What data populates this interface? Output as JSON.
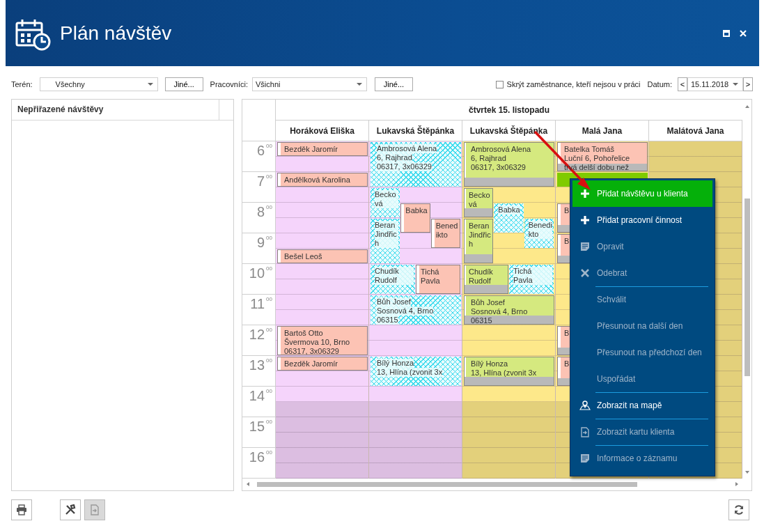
{
  "window": {
    "title": "Plán návštěv"
  },
  "filters": {
    "terrain": {
      "label": "Terén:",
      "value": "Všechny",
      "button": "Jiné..."
    },
    "workers": {
      "label": "Pracovníci:",
      "value": "Všichni",
      "button": "Jiné..."
    },
    "hide_absent": {
      "label": "Skrýt zaměstnance, kteří nejsou v práci",
      "checked": false
    },
    "date": {
      "label": "Datum:",
      "prev": "<",
      "value": "15.11.2018",
      "next": ">"
    }
  },
  "unassigned": {
    "title": "Nepřiřazené návštěvy"
  },
  "calendar": {
    "day": "čtvrtek 15. listopadu",
    "hours": [
      {
        "hour": "6",
        "minutes": "00"
      },
      {
        "hour": "7",
        "minutes": "00"
      },
      {
        "hour": "8",
        "minutes": "00"
      },
      {
        "hour": "9",
        "minutes": "00"
      },
      {
        "hour": "10",
        "minutes": "00"
      },
      {
        "hour": "11",
        "minutes": "00"
      },
      {
        "hour": "12",
        "minutes": "00"
      },
      {
        "hour": "13",
        "minutes": "00"
      },
      {
        "hour": "14",
        "minutes": "00"
      },
      {
        "hour": "15",
        "minutes": "00"
      },
      {
        "hour": "16",
        "minutes": "00"
      }
    ],
    "columns": [
      {
        "name": "Horáková Eliška",
        "events": [
          {
            "kind": "visit",
            "flag": false,
            "lines": [
              "Bezděk Jaromír"
            ]
          },
          {
            "kind": "visit",
            "flag": false,
            "lines": [
              "Andělková Karolina"
            ]
          },
          {
            "kind": "visit",
            "flag": false,
            "lines": [
              "Bešel Leoš"
            ]
          },
          {
            "kind": "visit",
            "flag": false,
            "lines": [
              "Bartoš Otto",
              "Švermova 10, Brno",
              "06317, 3x06329"
            ]
          },
          {
            "kind": "visit",
            "flag": false,
            "lines": [
              "Bezděk Jaromír"
            ]
          }
        ]
      },
      {
        "name": "Lukavská Štěpánka",
        "events": [
          {
            "kind": "hatched",
            "flag": false,
            "lines": [
              "Ambrosová Alena",
              "6, Rajhrad",
              "06317, 3x06329"
            ]
          },
          {
            "kind": "hatched",
            "flag": false,
            "lines": [
              "Becková"
            ]
          },
          {
            "kind": "hatched",
            "flag": false,
            "lines": [
              "Beran Jindřich"
            ]
          },
          {
            "kind": "visit",
            "flag": false,
            "lines": [
              "Babka"
            ]
          },
          {
            "kind": "visit",
            "flag": false,
            "lines": [
              "Benedikto"
            ]
          },
          {
            "kind": "hatched",
            "flag": false,
            "lines": [
              "Chudík Rudolf"
            ]
          },
          {
            "kind": "visit",
            "flag": false,
            "lines": [
              "Tichá Pavla"
            ]
          },
          {
            "kind": "hatched",
            "flag": false,
            "lines": [
              "Bůh Josef",
              "Sosnová 4, Brno",
              "06315"
            ]
          },
          {
            "kind": "hatched",
            "flag": false,
            "lines": [
              "Bílý Honza",
              "13, Hlína (zvonit 3x"
            ]
          }
        ]
      },
      {
        "name": "Lukavská Štěpánka",
        "events": [
          {
            "kind": "approved",
            "flag": true,
            "lines": [
              "Ambrosová Alena",
              "6, Rajhrad",
              "06317, 3x06329"
            ]
          },
          {
            "kind": "approved",
            "flag": true,
            "lines": [
              "Becková"
            ]
          },
          {
            "kind": "approved",
            "flag": true,
            "lines": [
              "Beran Jindřich"
            ]
          },
          {
            "kind": "hatched",
            "flag": false,
            "lines": [
              "Babka"
            ]
          },
          {
            "kind": "hatched",
            "flag": false,
            "lines": [
              "Benedikto"
            ]
          },
          {
            "kind": "approved",
            "flag": true,
            "lines": [
              "Chudík Rudolf"
            ]
          },
          {
            "kind": "hatched",
            "flag": false,
            "lines": [
              "Tichá Pavla"
            ]
          },
          {
            "kind": "approved",
            "flag": true,
            "lines": [
              "Bůh Josef",
              "Sosnová 4, Brno",
              "06315"
            ]
          },
          {
            "kind": "approved",
            "flag": true,
            "lines": [
              "Bílý Honza",
              "13, Hlína (zvonit 3x"
            ]
          }
        ]
      },
      {
        "name": "Malá Jana",
        "events": [
          {
            "kind": "visit",
            "flag": true,
            "lines": [
              "Batelka Tomáš",
              "Luční 6, Pohořelice",
              "trvá delší dobu než"
            ]
          },
          {
            "kind": "slot",
            "flag": false
          },
          {
            "kind": "visit",
            "flag": true,
            "lines": [
              "B"
            ]
          },
          {
            "kind": "visit",
            "flag": true,
            "lines": [
              "B"
            ]
          },
          {
            "kind": "visit",
            "flag": true,
            "lines": [
              "B"
            ]
          },
          {
            "kind": "visit",
            "flag": true,
            "lines": [
              "B"
            ]
          }
        ]
      },
      {
        "name": "Malátová Jana"
      }
    ]
  },
  "context_menu": {
    "items": [
      {
        "label": "Přidat návštěvu u klienta",
        "disabled": false,
        "selected": true,
        "separator_before": false
      },
      {
        "label": "Přidat pracovní činnost",
        "disabled": false,
        "selected": false,
        "separator_before": false
      },
      {
        "label": "Opravit",
        "disabled": true,
        "selected": false,
        "separator_before": false
      },
      {
        "label": "Odebrat",
        "disabled": true,
        "selected": false,
        "separator_before": false
      },
      {
        "label": "Schválit",
        "disabled": true,
        "selected": false,
        "separator_before": true
      },
      {
        "label": "Přesunout na další den",
        "disabled": true,
        "selected": false,
        "separator_before": false
      },
      {
        "label": "Přesunout na předchozí den",
        "disabled": true,
        "selected": false,
        "separator_before": false
      },
      {
        "label": "Uspořádat",
        "disabled": true,
        "selected": false,
        "separator_before": false
      },
      {
        "label": "Zobrazit na mapě",
        "disabled": false,
        "selected": false,
        "separator_before": true
      },
      {
        "label": "Zobrazit kartu klienta",
        "disabled": true,
        "selected": false,
        "separator_before": true
      },
      {
        "label": "Informace o záznamu",
        "disabled": true,
        "selected": false,
        "separator_before": true
      }
    ]
  },
  "toolbar": {
    "buttons": [
      {
        "disabled": false
      },
      {
        "disabled": false
      },
      {
        "disabled": true
      }
    ],
    "refresh": {
      "disabled": false
    }
  }
}
